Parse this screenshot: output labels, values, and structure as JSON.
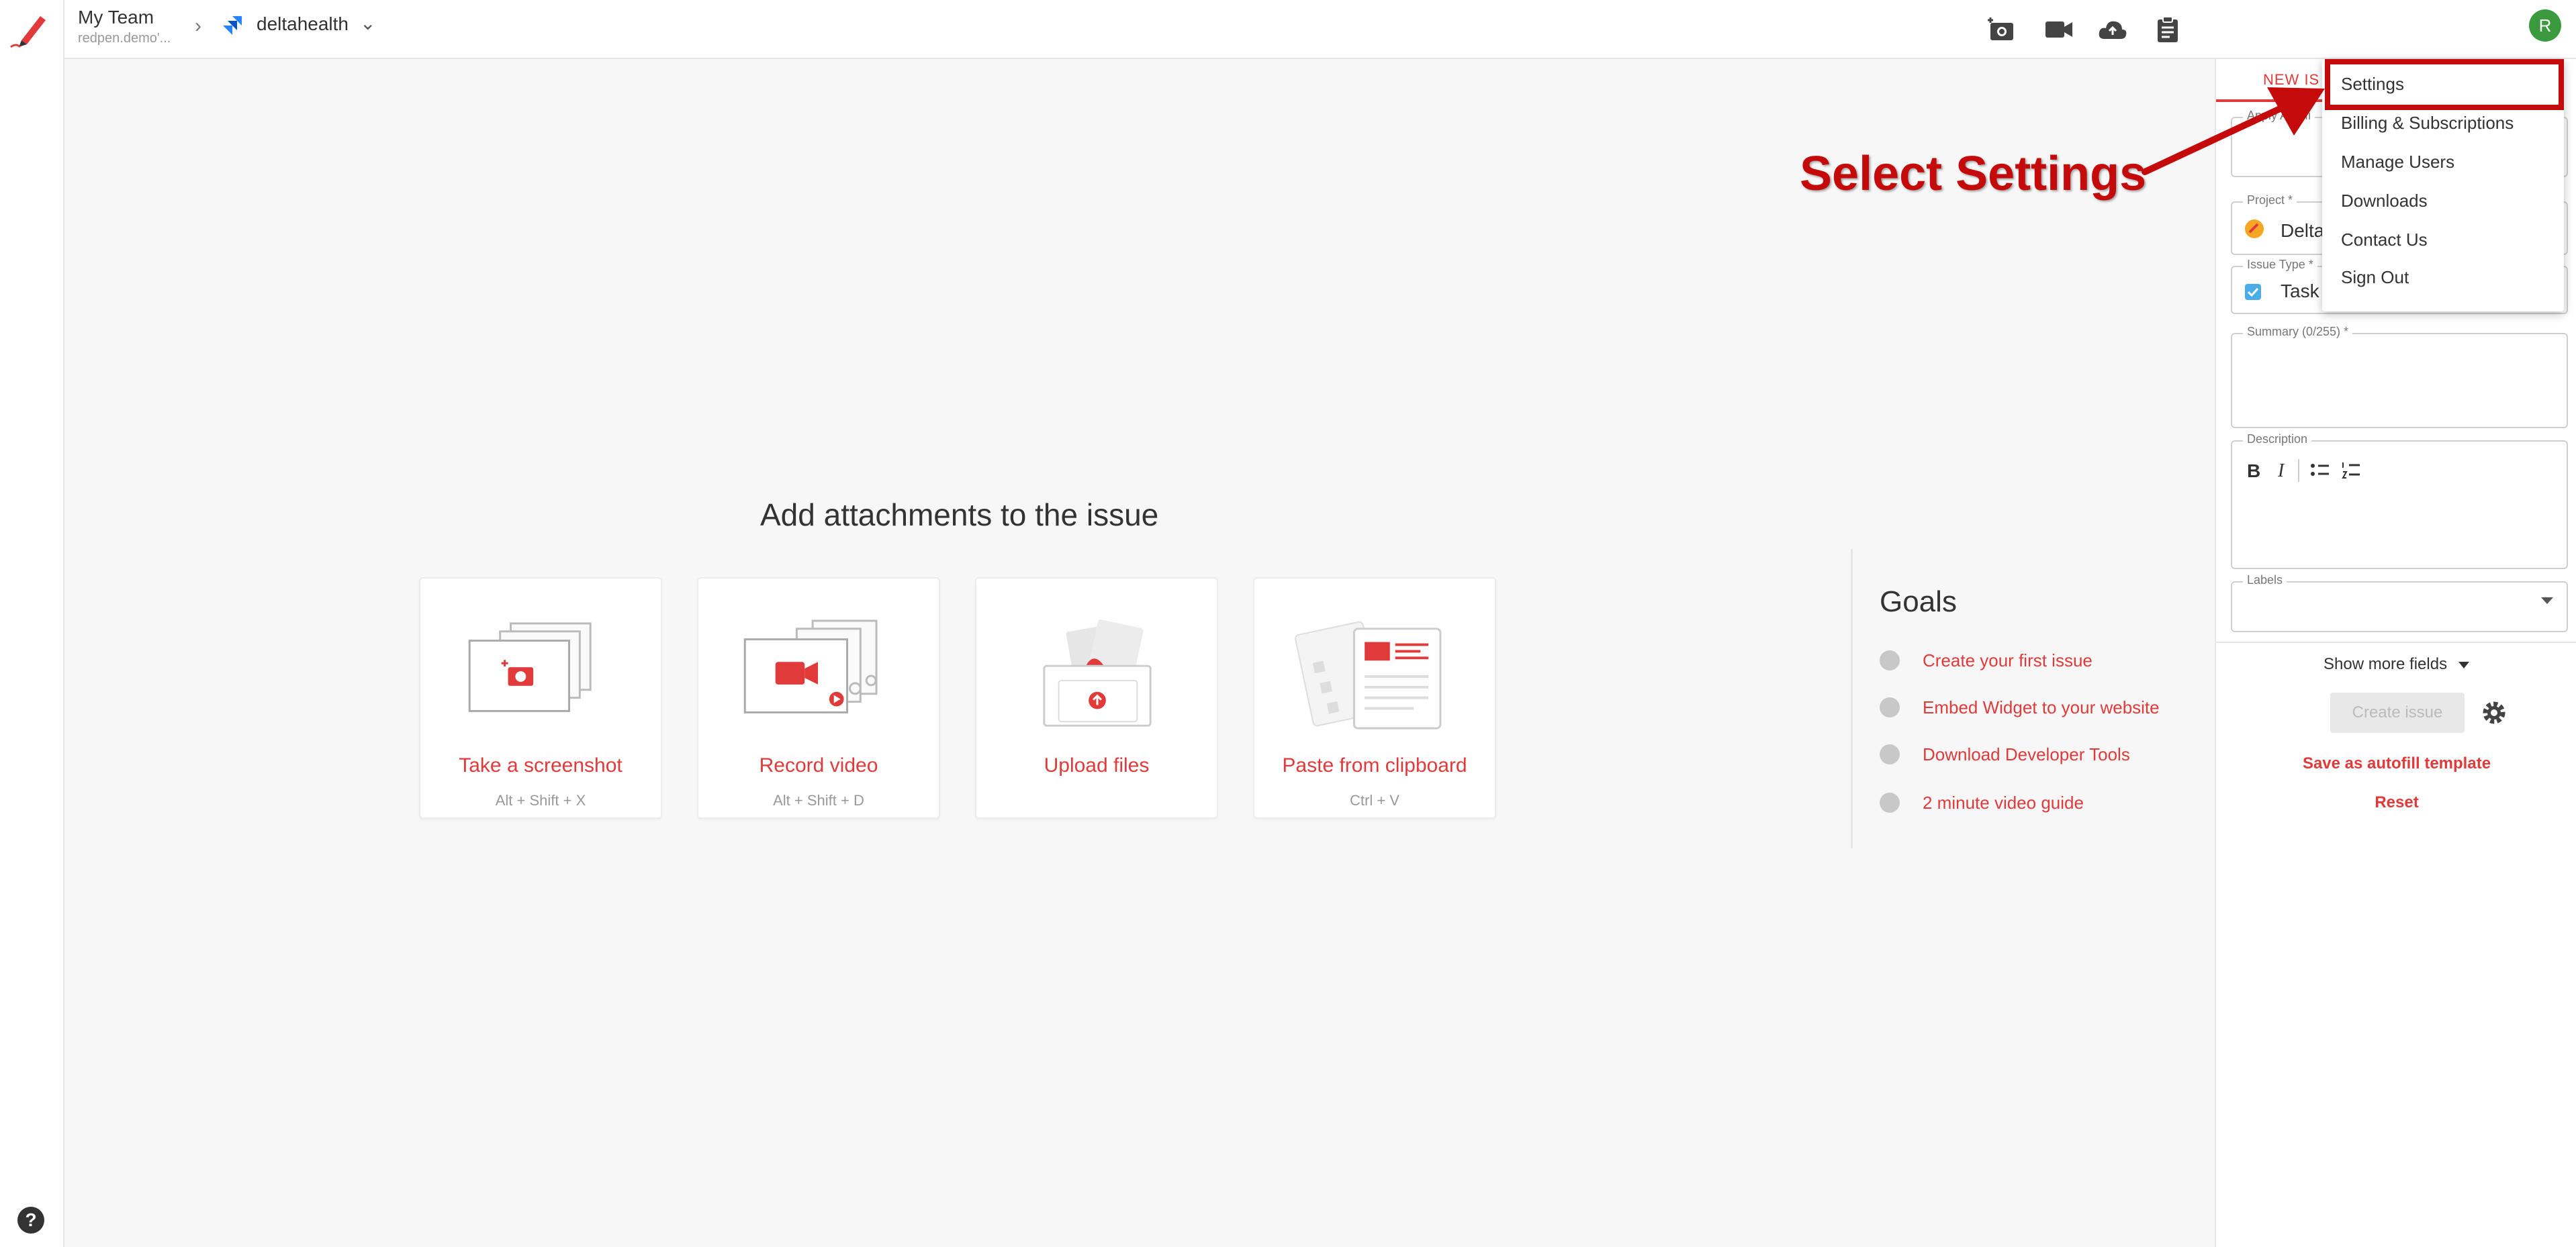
{
  "header": {
    "team_name": "My Team",
    "team_url": "redpen.demo'...",
    "project_name": "deltahealth",
    "avatar_initial": "R"
  },
  "main": {
    "title": "Add attachments to the issue",
    "cards": [
      {
        "label": "Take a screenshot",
        "hint": "Alt + Shift + X",
        "icon": "screenshot-icon"
      },
      {
        "label": "Record video",
        "hint": "Alt + Shift + D",
        "icon": "video-icon"
      },
      {
        "label": "Upload files",
        "hint": "",
        "icon": "upload-icon"
      },
      {
        "label": "Paste from clipboard",
        "hint": "Ctrl + V",
        "icon": "clipboard-icon"
      }
    ]
  },
  "goals": {
    "title": "Goals",
    "items": [
      "Create your first issue",
      "Embed Widget to your website",
      "Download Developer Tools",
      "2 minute video guide"
    ]
  },
  "panel": {
    "tab": "NEW IS",
    "autofill_label": "Apply Autofi",
    "project_label": "Project *",
    "project_value": "Delta",
    "issue_type_label": "Issue Type *",
    "issue_type_value": "Task",
    "summary_label": "Summary (0/255) *",
    "description_label": "Description",
    "bold": "B",
    "italic": "I",
    "labels_label": "Labels",
    "show_more": "Show more fields",
    "create_button": "Create issue",
    "save_autofill": "Save as autofill template",
    "reset": "Reset"
  },
  "menu": {
    "items": [
      "Settings",
      "Billing & Subscriptions",
      "Manage Users",
      "Downloads",
      "Contact Us",
      "Sign Out"
    ]
  },
  "annotation": {
    "text": "Select Settings"
  },
  "colors": {
    "accent": "#e03a3a",
    "annotation": "#c40a0a",
    "avatar": "#3a9b3e"
  }
}
